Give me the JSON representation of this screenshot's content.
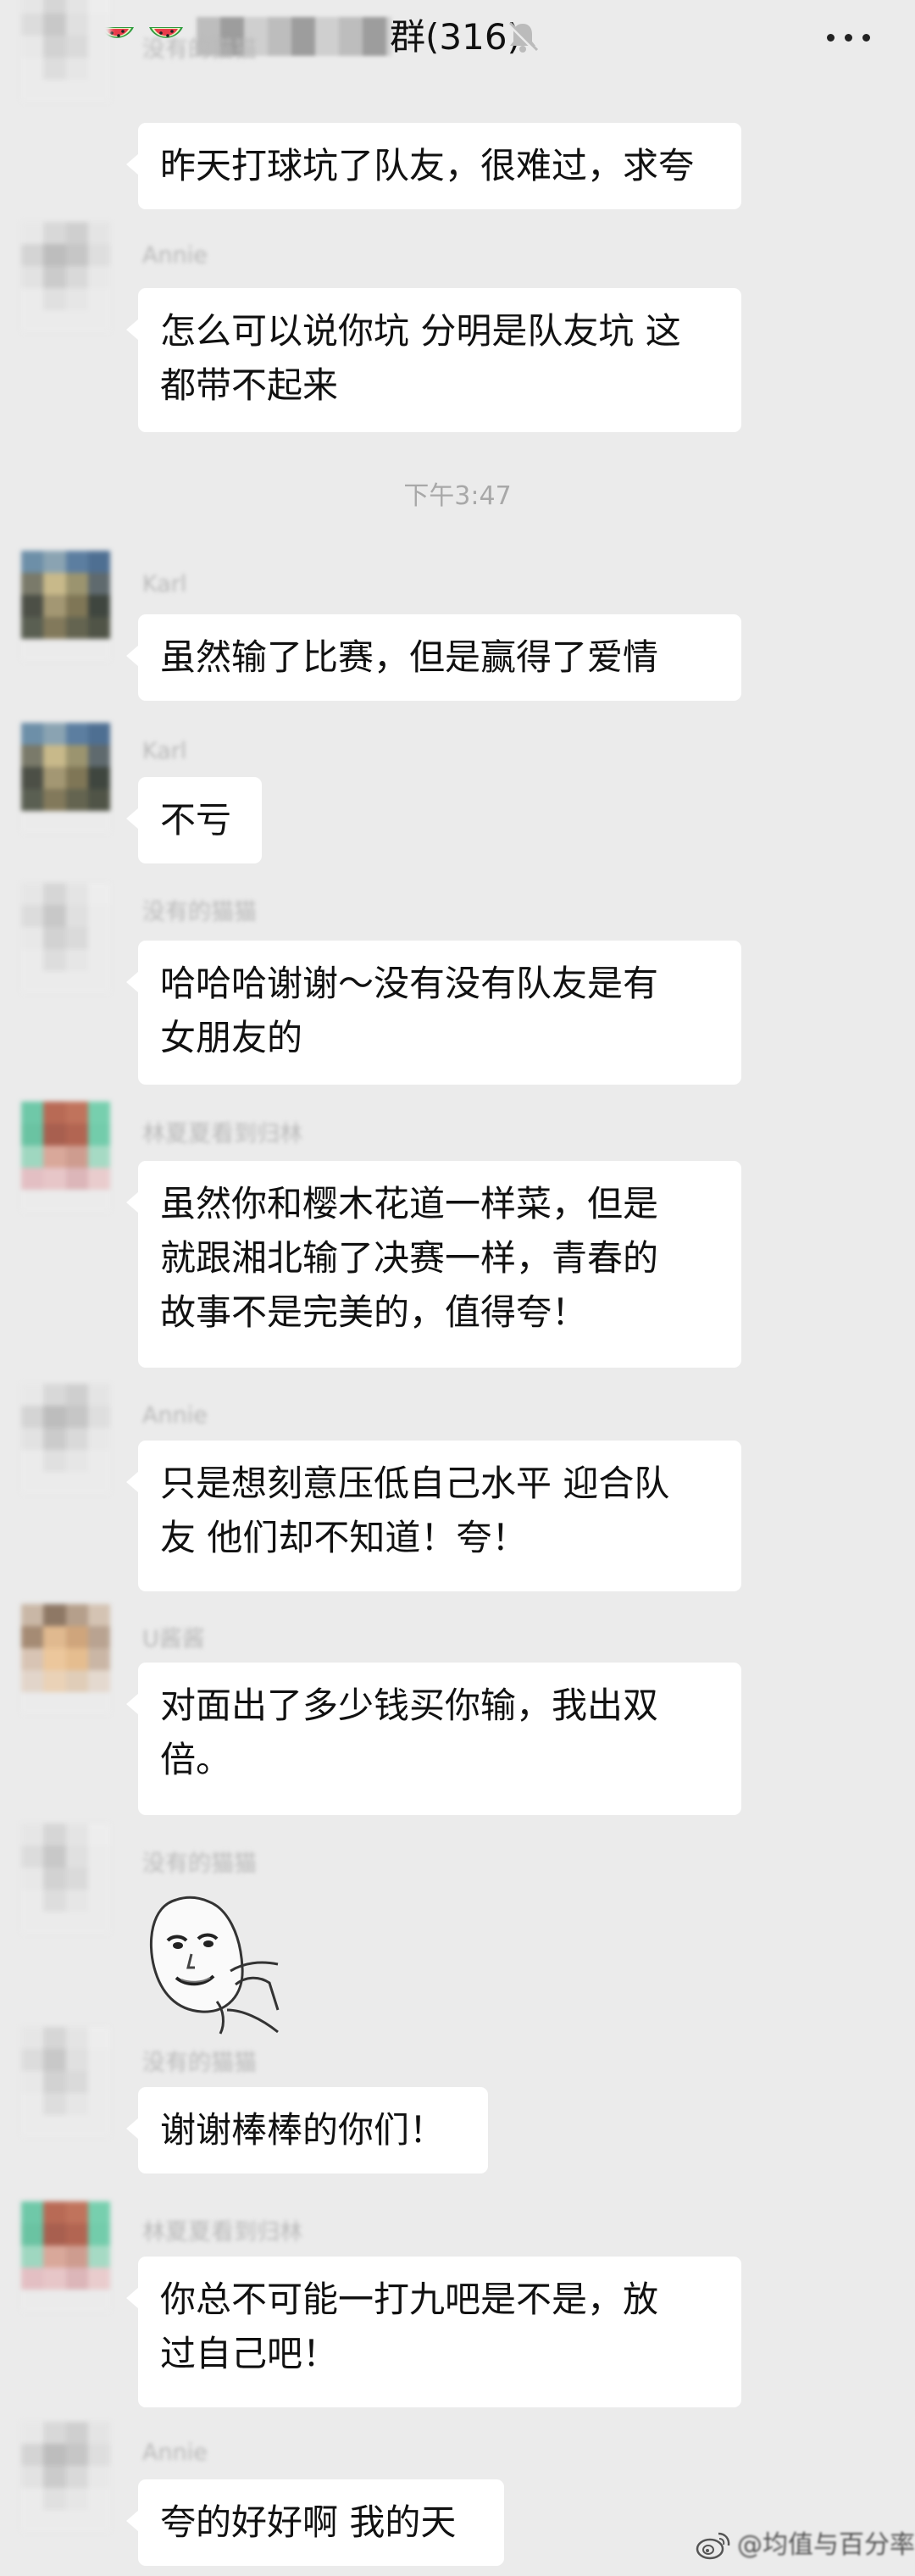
{
  "header": {
    "title": "群(316)",
    "back_icon": "chevron-left-icon",
    "mute_icon": "bell-slash-icon",
    "menu_icon": "more-dots-icon",
    "emoji_icon": "watermelon-icon"
  },
  "time_divider": "下午3:47",
  "messages": [
    {
      "sender": "没有的猫猫",
      "text": "昨天打球坑了队友，很难过，求夸"
    },
    {
      "sender": "Annie",
      "text": "怎么可以说你坑 分明是队友坑 这\n都带不起来"
    },
    {
      "sender": "Karl",
      "text": "虽然输了比赛，但是赢得了爱情"
    },
    {
      "sender": "Karl",
      "text": "不亏"
    },
    {
      "sender": "没有的猫猫",
      "text": "哈哈哈谢谢～没有没有队友是有\n女朋友的"
    },
    {
      "sender": "林夏夏看到归林",
      "text": "虽然你和樱木花道一样菜，但是\n就跟湘北输了决赛一样，青春的\n故事不是完美的，值得夸！"
    },
    {
      "sender": "Annie",
      "text": "只是想刻意压低自己水平 迎合队\n友 他们却不知道！夸！"
    },
    {
      "sender": "U酱酱",
      "text": "对面出了多少钱买你输，我出双\n倍。"
    },
    {
      "sender": "没有的猫猫",
      "text": "",
      "sticker": "meme-face-sticker"
    },
    {
      "sender": "没有的猫猫",
      "text": "谢谢棒棒的你们！"
    },
    {
      "sender": "林夏夏看到归林",
      "text": "你总不可能一打九吧是不是，放\n过自己吧！"
    },
    {
      "sender": "Annie",
      "text": "夸的好好啊 我的天"
    }
  ],
  "watermark": {
    "text": "@均值与百分率",
    "icon": "weibo-icon"
  },
  "colors": {
    "background": "#ebebeb",
    "bubble": "#ffffff",
    "text": "#111111",
    "muted_text": "#a8a8a8"
  }
}
